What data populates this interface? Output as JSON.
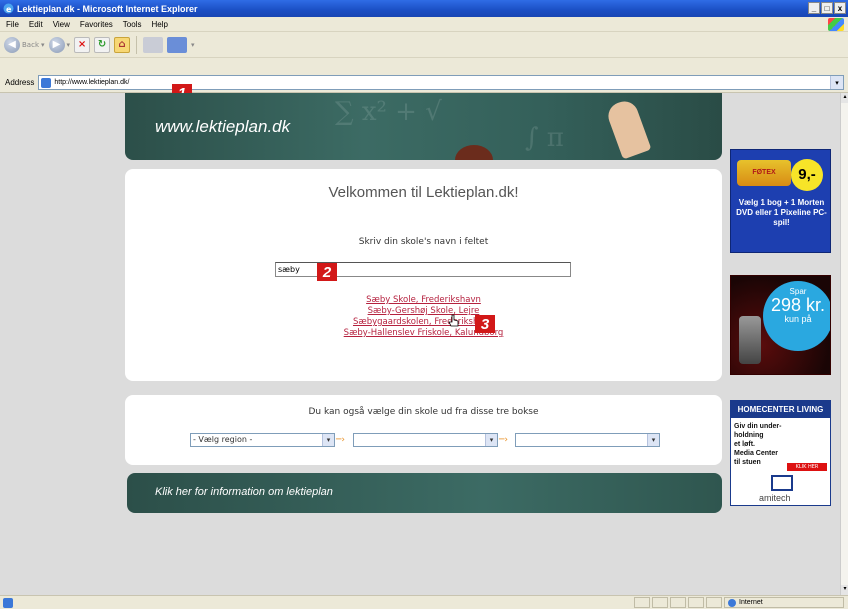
{
  "window": {
    "title": "Lektieplan.dk - Microsoft Internet Explorer",
    "minimize": "_",
    "maximize": "□",
    "close": "x"
  },
  "menu": [
    "File",
    "Edit",
    "View",
    "Favorites",
    "Tools",
    "Help"
  ],
  "toolbar": {
    "back_label": "Back",
    "forward_label": ""
  },
  "address": {
    "label": "Address",
    "url": "http://www.lektieplan.dk/"
  },
  "markers": [
    "1",
    "2",
    "3"
  ],
  "page": {
    "logo": "www.lektieplan.dk",
    "welcome": "Velkommen til Lektieplan.dk!",
    "instruction": "Skriv din skole's navn i feltet",
    "search_value": "sæby",
    "suggestions": [
      "Sæby Skole, Frederikshavn",
      "Sæby-Gershøj Skole, Lejre",
      "Sæbygaardskolen, Frederikshavn",
      "Sæby-Hallenslev Friskole, Kalundborg"
    ],
    "select_title": "Du kan også vælge din skole ud fra disse tre bokse",
    "region_select": "- Vælg region -",
    "info_banner": "Klik her for information om lektieplan"
  },
  "ads": {
    "ad1": {
      "brand": "FØTEX",
      "price": "9,-",
      "text": "Vælg 1 bog + 1 Morten DVD eller 1 Pixeline PC-spil!"
    },
    "ad2": {
      "line1": "Spar",
      "line2": "298 kr.",
      "line3": "kun på"
    },
    "ad3": {
      "title": "HOMECENTER LIVING",
      "text_lines": [
        "Giv din under-",
        "holdning",
        "et løft.",
        "Media Center",
        "til stuen"
      ],
      "cta": "KLIK HER",
      "brand": "amitech"
    }
  },
  "status": {
    "zone": "Internet"
  },
  "colors": {
    "titlebar": "#1b4fc4",
    "link": "#b5213e",
    "banner": "#34605a",
    "marker": "#d21818"
  }
}
